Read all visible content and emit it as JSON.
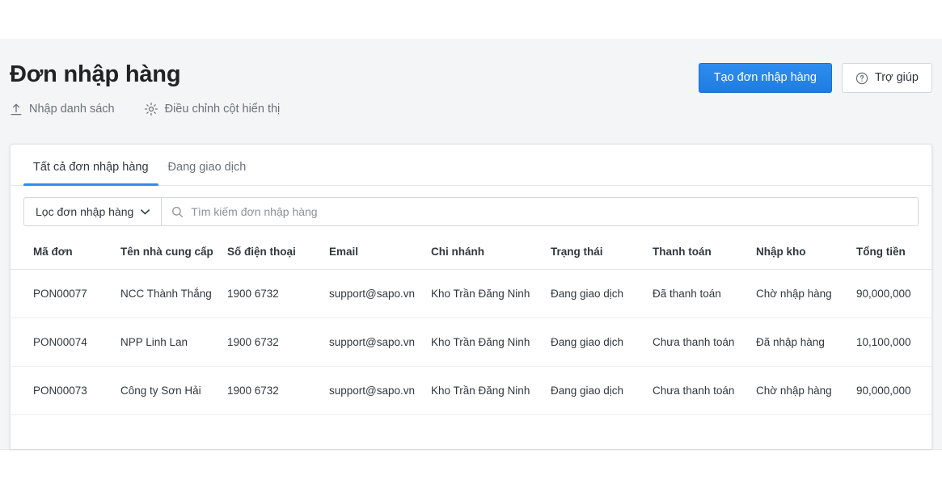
{
  "header": {
    "title": "Đơn nhập hàng",
    "primary_button": "Tạo đơn nhập hàng",
    "help_button": "Trợ giúp",
    "help_icon": "question-circle-icon",
    "subactions": [
      {
        "label": "Nhập danh sách",
        "icon": "upload-icon"
      },
      {
        "label": "Điều chỉnh cột hiển thị",
        "icon": "gear-icon"
      }
    ]
  },
  "tabs": [
    {
      "label": "Tất cả đơn nhập hàng",
      "active": true
    },
    {
      "label": "Đang giao dịch",
      "active": false
    }
  ],
  "filter": {
    "dropdown_label": "Lọc đơn nhập hàng",
    "dropdown_icon": "chevron-down-icon",
    "search_icon": "search-icon",
    "search_placeholder": "Tìm kiếm đơn nhập hàng",
    "search_value": ""
  },
  "table": {
    "columns": [
      "Mã đơn",
      "Tên nhà cung cấp",
      "Số điện thoại",
      "Email",
      "Chi nhánh",
      "Trạng thái",
      "Thanh toán",
      "Nhập kho",
      "Tổng tiền"
    ],
    "rows": [
      {
        "code": "PON00077",
        "supplier": "NCC Thành Thắng",
        "phone": "1900 6732",
        "email": "support@sapo.vn",
        "branch": "Kho Trần Đăng Ninh",
        "status": "Đang giao dịch",
        "payment": "Đã thanh toán",
        "receipt": "Chờ nhập hàng",
        "total": "90,000,000"
      },
      {
        "code": "PON00074",
        "supplier": "NPP Linh Lan",
        "phone": "1900 6732",
        "email": "support@sapo.vn",
        "branch": "Kho Trần Đăng Ninh",
        "status": "Đang giao dịch",
        "payment": "Chưa thanh toán",
        "receipt": "Đã nhập hàng",
        "total": "10,100,000"
      },
      {
        "code": "PON00073",
        "supplier": "Công ty Sơn Hải",
        "phone": "1900 6732",
        "email": "support@sapo.vn",
        "branch": "Kho Trần Đăng Ninh",
        "status": "Đang giao dịch",
        "payment": "Chưa thanh toán",
        "receipt": "Chờ nhập hàng",
        "total": "90,000,000"
      }
    ]
  },
  "colors": {
    "accent": "#2f8df0",
    "link": "#4a90d9",
    "status_pending": "#e29142",
    "page_bg": "#f4f5f7",
    "text": "#31373d"
  }
}
